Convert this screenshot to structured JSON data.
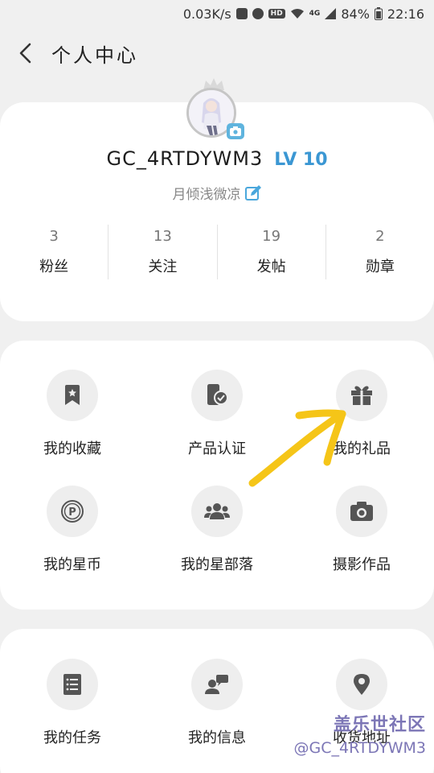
{
  "status_bar": {
    "speed": "0.03K/s",
    "network": "4G",
    "battery": "84%",
    "time": "22:16"
  },
  "header": {
    "title": "个人中心"
  },
  "profile": {
    "username": "GC_4RTDYWM3",
    "level": "LV 10",
    "signature": "月倾浅微凉",
    "stats": [
      {
        "count": "3",
        "label": "粉丝"
      },
      {
        "count": "13",
        "label": "关注"
      },
      {
        "count": "19",
        "label": "发帖"
      },
      {
        "count": "2",
        "label": "勋章"
      }
    ]
  },
  "services": {
    "items": [
      {
        "label": "我的收藏",
        "icon": "bookmark-icon"
      },
      {
        "label": "产品认证",
        "icon": "phone-check-icon"
      },
      {
        "label": "我的礼品",
        "icon": "gift-icon"
      },
      {
        "label": "我的星币",
        "icon": "coin-icon"
      },
      {
        "label": "我的星部落",
        "icon": "group-icon"
      },
      {
        "label": "摄影作品",
        "icon": "camera-icon"
      }
    ]
  },
  "tasks": {
    "items": [
      {
        "label": "我的任务",
        "icon": "document-icon"
      },
      {
        "label": "我的信息",
        "icon": "contact-message-icon"
      },
      {
        "label": "收货地址",
        "icon": "location-pin-icon"
      }
    ]
  },
  "watermark": {
    "brand": "盖乐世社区",
    "handle": "@GC_4RTDYWM3"
  },
  "colors": {
    "accent": "#3b97d3",
    "annotation_arrow": "#f5c518",
    "card_bg": "#ffffff",
    "page_bg": "#f0f0f0"
  }
}
